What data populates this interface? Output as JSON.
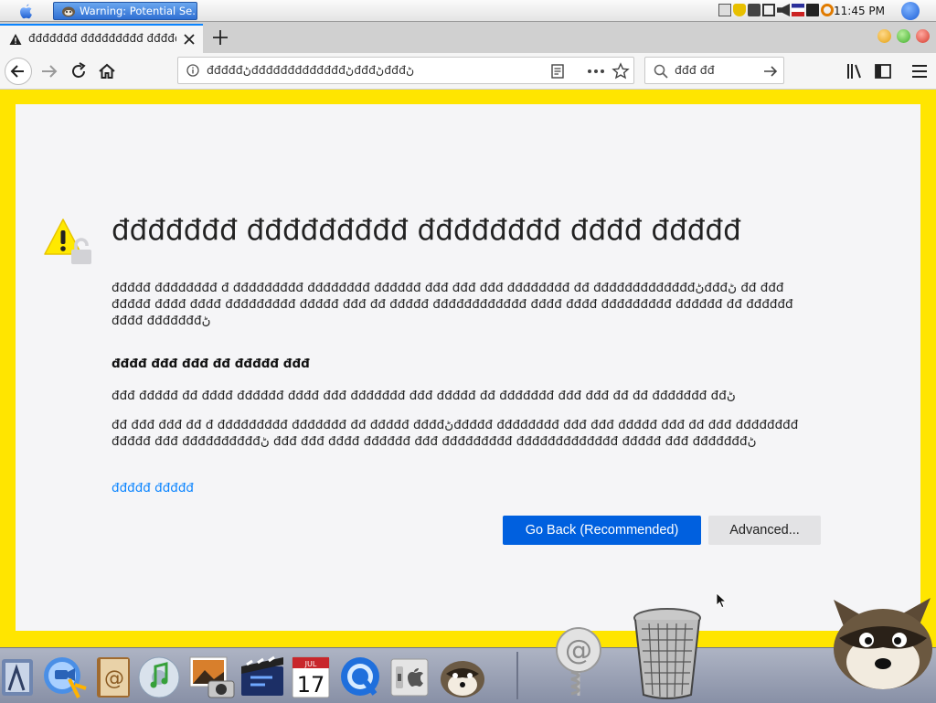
{
  "menubar": {
    "task_title": "Warning: Potential Se...",
    "clock": "11:45 PM"
  },
  "browser": {
    "tab_title": "đđđđđđđ đđđđđđđđđ đđđđđđđđ",
    "url": "đđđđđڻđđđđđđđđđđđđđڻđđđڻđđđڻ",
    "search_text": "đđđ đđ"
  },
  "error_page": {
    "title": "đđđđđđđ đđđđđđđđđ đđđđđđđđ đđđđ đđđđđ",
    "para1": "đđđđđ đđđđđđđđ đ đđđđđđđđđ đđđđđđđđ đđđđđđ đđđ đđđ đđđ đđđđđđđđ đđ đđđđđđđđđđđđđڻđđđڻ đđ đđđ đđđđđ đđđđ đđđđ đđđđđđđđđ đđđđđ đđđ đđ đđđđđ đđđđđđđđđđđđ đđđđ đđđđ đđđđđđđđđ đđđđđđ đđ đđđđđđ đđđđ đđđđđđđڻ",
    "heading": "đđđđ đđđ đđđ đđ đđđđđ đđđ",
    "para2": "đđđ đđđđđ đđ đđđđ đđđđđđ đđđđ đđđ đđđđđđđ đđđ đđđđđ đđ đđđđđđđ đđđ đđđ đđ đđ đđđđđđđ đđڻ",
    "para3": "đđ đđđ đđđ đđ đ đđđđđđđđđ đđđđđđđ đđ đđđđđ đđđđڻđđđđđ đđđđđđđđ đđđ đđđ đđđđđ đđđ đđ đđđ đđđđđđđđ đđđđđ đđđ đđđđđđđđđđڻ đđđ đđđ đđđđ đđđđđđ đđđ đđđđđđđđđ đđđđđđđđđđđđđ đđđđđ đđđ đđđđđđđڻ",
    "learn_more": "đđđđđ đđđđđ",
    "go_back_label": "Go Back (Recommended)",
    "advanced_label": "Advanced..."
  },
  "colors": {
    "warning_stripe": "#ffe500",
    "primary_button": "#0060df",
    "link": "#0a84ff"
  },
  "icons": {
    "dock": [
      "finder-icon",
      "ichat-icon",
      "address-book-icon",
      "itunes-icon",
      "iphoto-icon",
      "imovie-icon",
      "ical-icon",
      "quicktime-icon",
      "system-preferences-icon",
      "camino-icon",
      "mail-icon",
      "trash-icon"
    ],
    "ical_day": "17",
    "ical_month": "JUL"
  }
}
